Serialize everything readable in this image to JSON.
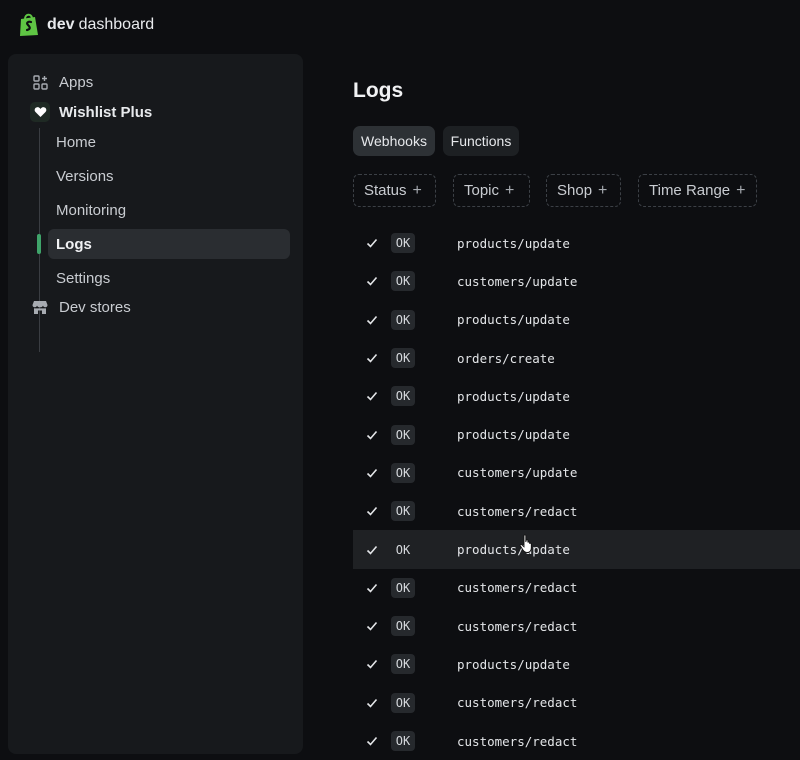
{
  "brand": {
    "name_bold": "dev",
    "name_rest": "dashboard"
  },
  "sidebar": {
    "apps_label": "Apps",
    "app_name": "Wishlist Plus",
    "items": [
      {
        "label": "Home"
      },
      {
        "label": "Versions"
      },
      {
        "label": "Monitoring"
      },
      {
        "label": "Logs",
        "active": true
      },
      {
        "label": "Settings"
      }
    ],
    "dev_stores_label": "Dev stores"
  },
  "page": {
    "title": "Logs"
  },
  "tabs": [
    {
      "label": "Webhooks",
      "selected": true
    },
    {
      "label": "Functions"
    }
  ],
  "filters": [
    {
      "label": "Status"
    },
    {
      "label": "Topic"
    },
    {
      "label": "Shop"
    },
    {
      "label": "Time Range"
    }
  ],
  "logs": [
    {
      "status": "OK",
      "topic": "products/update"
    },
    {
      "status": "OK",
      "topic": "customers/update"
    },
    {
      "status": "OK",
      "topic": "products/update"
    },
    {
      "status": "OK",
      "topic": "orders/create"
    },
    {
      "status": "OK",
      "topic": "products/update"
    },
    {
      "status": "OK",
      "topic": "products/update"
    },
    {
      "status": "OK",
      "topic": "customers/update"
    },
    {
      "status": "OK",
      "topic": "customers/redact"
    },
    {
      "status": "OK",
      "topic": "products/update"
    },
    {
      "status": "OK",
      "topic": "customers/redact"
    },
    {
      "status": "OK",
      "topic": "customers/redact"
    },
    {
      "status": "OK",
      "topic": "products/update"
    },
    {
      "status": "OK",
      "topic": "customers/redact"
    },
    {
      "status": "OK",
      "topic": "customers/redact"
    }
  ],
  "icons": {
    "brand": "shopify-bag-icon",
    "apps": "apps-grid-icon",
    "app": "heart-icon",
    "dev_stores": "store-icon",
    "row_status": "checkmark-icon",
    "filter_add": "plus-icon",
    "cursor": "pointer-hand-icon"
  },
  "colors": {
    "accent": "#3fa46a",
    "brand": "#5fc544",
    "background": "#0d0e11",
    "sidebar": "#17191c"
  }
}
